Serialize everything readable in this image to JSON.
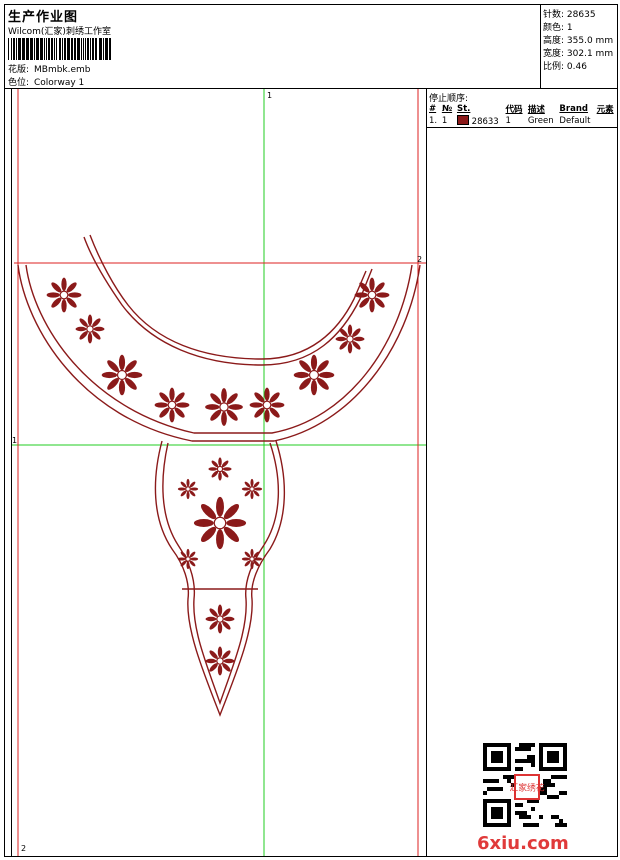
{
  "header": {
    "title": "生产作业图",
    "company": "Wilcom(汇家)刺绣工作室",
    "design_label": "花版:",
    "design_file": "MBmbk.emb",
    "colorway_label": "色位:",
    "colorway": "Colorway 1"
  },
  "stats": [
    {
      "label": "针数:",
      "value": "28635"
    },
    {
      "label": "颜色:",
      "value": "1"
    },
    {
      "label": "高度:",
      "value": "355.0 mm"
    },
    {
      "label": "宽度:",
      "value": "302.1 mm"
    },
    {
      "label": "比例:",
      "value": "0.46"
    }
  ],
  "stop_sequence": {
    "title": "停止顺序:",
    "columns": [
      "#",
      "№",
      "St.",
      "代码",
      "描述",
      "Brand",
      "元素"
    ],
    "rows": [
      {
        "num": "1.",
        "no": "1",
        "stitches": "28633",
        "code": "1",
        "desc": "Green",
        "brand": "Default",
        "color": "#8b1a1a"
      }
    ]
  },
  "guides": {
    "v1": "1",
    "h2": "2",
    "h1": "1",
    "b2": "2"
  },
  "colors": {
    "thread": "#8b1a1a",
    "guide_green": "#22cc22",
    "guide_red": "#dd2222"
  },
  "watermark": "6xiu.com",
  "stamp": "汇家绣花"
}
